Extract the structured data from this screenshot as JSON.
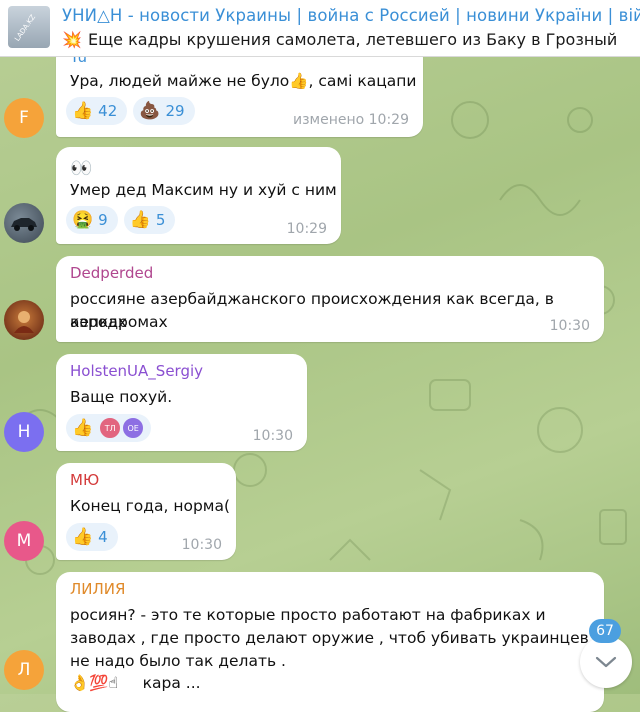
{
  "header": {
    "thumb_text": "LADA.KZ",
    "channel_title": "УНИ△Н - новости Украины | война с Россией | новини України | вій...",
    "pinned_emoji": "💥",
    "pinned_text": "Еще кадры крушения самолета, летевшего из Баку в Грозный"
  },
  "messages": [
    {
      "sender": "Yu",
      "text": "Ура, людей майже не було👍, самі кацапи",
      "reactions": [
        {
          "emoji": "👍",
          "count": "42"
        },
        {
          "emoji": "💩",
          "count": "29"
        }
      ],
      "time": "изменено 10:29",
      "avatar_letter": "F",
      "avatar_color": "#f5a33a"
    },
    {
      "sender": "",
      "lines": [
        "👀",
        "Умер дед Максим ну и хуй с ним"
      ],
      "reactions": [
        {
          "emoji": "🤮",
          "count": "9"
        },
        {
          "emoji": "👍",
          "count": "5"
        }
      ],
      "time": "10:29",
      "avatar_color": "#5a6a78"
    },
    {
      "sender": "Dedperded",
      "sender_color": "#b0478f",
      "lines": [
        "россияне азербайджанского происхождения как всегда, в кепках",
        "аэродромах"
      ],
      "time": "10:30",
      "avatar_color": "#8a3a22"
    },
    {
      "sender": "HolstenUA_Sergiy",
      "sender_color": "#8a4fd1",
      "text": "Ваще похуй.",
      "reaction_emoji": "👍",
      "reactor_avatars": [
        {
          "label": "ТЛ",
          "color": "#e2657f"
        },
        {
          "label": "OE",
          "color": "#8d6fe3"
        }
      ],
      "time": "10:30",
      "avatar_letter": "H",
      "avatar_color": "#7b6ff0"
    },
    {
      "sender": "МЮ",
      "sender_color": "#d43c3c",
      "text": "Конец года, норма(",
      "reactions": [
        {
          "emoji": "👍",
          "count": "4"
        }
      ],
      "time": "10:30",
      "avatar_letter": "M",
      "avatar_color": "#e8588a"
    },
    {
      "sender": "ЛИЛИЯ",
      "sender_color": "#e08a2a",
      "lines": [
        "росиян?  -  это те которые просто работают на  фабриках и",
        "заводах , где просто делают оружие , чтоб убивать украинцев ?",
        "не надо было так делать ."
      ],
      "last_line": "👌💯☝     кара ...",
      "avatar_letter": "Л",
      "avatar_color": "#f5a33a"
    }
  ],
  "unread_count": "67",
  "colors": {
    "accent": "#3a8fd6",
    "reaction_bg": "#e9f2fb",
    "time": "#a0a6ac"
  }
}
